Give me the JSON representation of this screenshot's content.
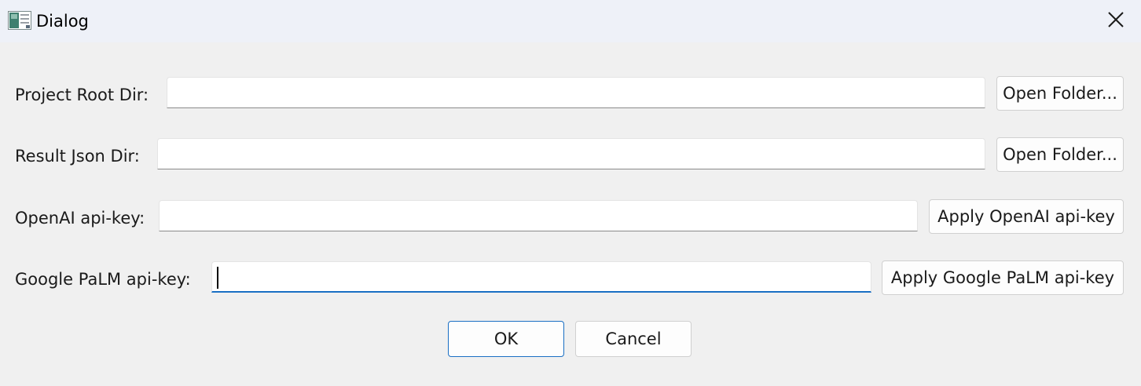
{
  "window": {
    "title": "Dialog",
    "icon": "app-window-icon",
    "close_icon": "close-icon"
  },
  "rows": [
    {
      "label": "Project Root Dir:",
      "value": "",
      "button": "Open Folder..."
    },
    {
      "label": "Result Json Dir:",
      "value": "",
      "button": "Open Folder..."
    },
    {
      "label": "OpenAI api-key:",
      "value": "",
      "button": "Apply OpenAI api-key"
    },
    {
      "label": "Google PaLM api-key:",
      "value": "",
      "button": "Apply Google PaLM api-key"
    }
  ],
  "footer": {
    "ok_label": "OK",
    "cancel_label": "Cancel"
  },
  "colors": {
    "focus_accent": "#1a6fc4",
    "background": "#f0f0f0",
    "titlebar": "#eef1f8"
  }
}
